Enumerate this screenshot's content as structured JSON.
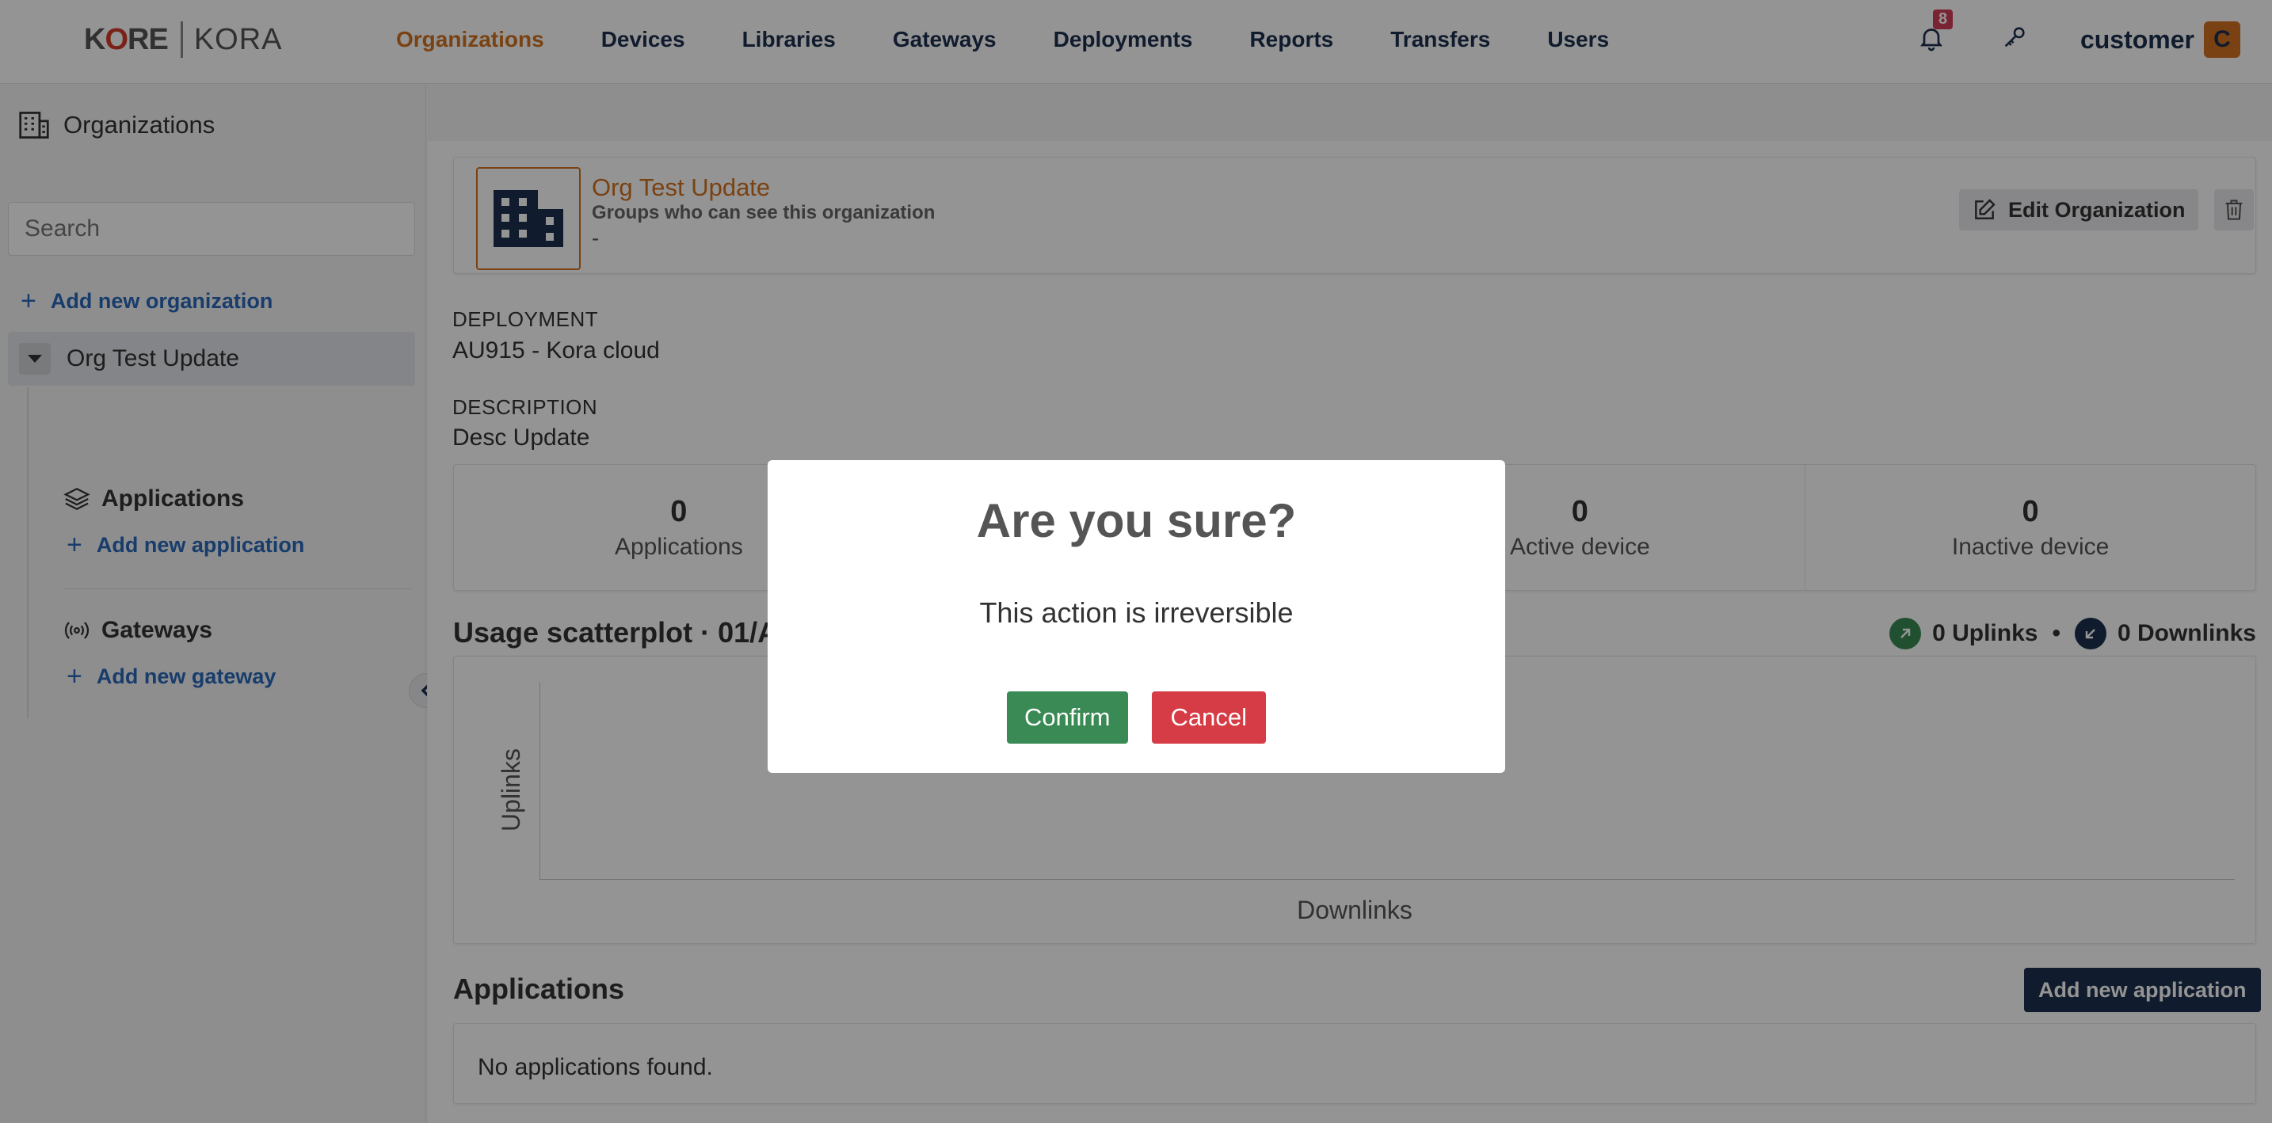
{
  "brand": {
    "logo_left": "KORE",
    "logo_right": "KORA"
  },
  "nav": {
    "items": [
      {
        "label": "Organizations",
        "active": true
      },
      {
        "label": "Devices"
      },
      {
        "label": "Libraries"
      },
      {
        "label": "Gateways"
      },
      {
        "label": "Deployments"
      },
      {
        "label": "Reports"
      },
      {
        "label": "Transfers"
      },
      {
        "label": "Users"
      }
    ],
    "notification_count": "8",
    "user_name": "customer",
    "avatar_initial": "C"
  },
  "sidebar": {
    "title": "Organizations",
    "search_placeholder": "Search",
    "add_org": "Add new organization",
    "org_name": "Org Test Update",
    "applications_label": "Applications",
    "add_application": "Add new application",
    "gateways_label": "Gateways",
    "add_gateway": "Add new gateway"
  },
  "org": {
    "name": "Org Test Update",
    "groups_label": "Groups who can see this organization",
    "groups_value": "-",
    "edit_button": "Edit Organization",
    "deployment_label": "DEPLOYMENT",
    "deployment_value": "AU915 - Kora cloud",
    "description_label": "DESCRIPTION",
    "description_value": "Desc Update"
  },
  "stats": [
    {
      "value": "0",
      "label": "Applications"
    },
    {
      "value": "0",
      "label": ""
    },
    {
      "value": "0",
      "label": "Active device"
    },
    {
      "value": "0",
      "label": "Inactive device"
    }
  ],
  "usage": {
    "title": "Usage scatterplot · 01/A",
    "uplinks": "0 Uplinks",
    "separator": "•",
    "downlinks": "0 Downlinks",
    "y_label": "Uplinks",
    "x_label": "Downlinks"
  },
  "applications": {
    "title": "Applications",
    "add_button": "Add new application",
    "empty_text": "No applications found."
  },
  "modal": {
    "title": "Are you sure?",
    "text": "This action is irreversible",
    "confirm": "Confirm",
    "cancel": "Cancel"
  },
  "colors": {
    "accent_orange": "#d3731f",
    "navy": "#1d2f4f",
    "link_blue": "#2a68b8",
    "confirm_green": "#3a8a55",
    "cancel_red": "#d63c46",
    "badge_red": "#d33d57",
    "uplink_green": "#3a8a55"
  },
  "icons": [
    "building-icon",
    "bell-icon",
    "key-icon",
    "layers-icon",
    "broadcast-icon",
    "edit-icon",
    "trash-icon",
    "chevron-left-icon",
    "caret-down-icon",
    "arrow-up-right-icon",
    "arrow-down-left-icon"
  ]
}
